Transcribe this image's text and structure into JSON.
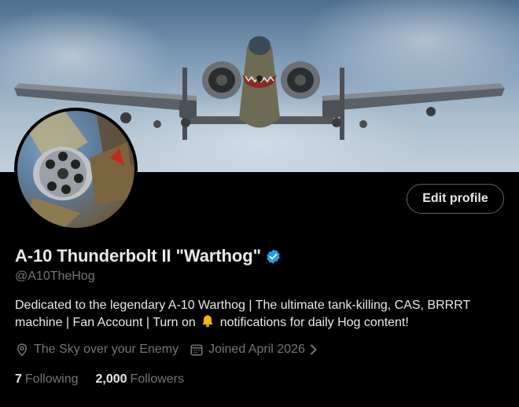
{
  "banner": {
    "image": "A-10 Warthog aircraft flying toward camera against cloudy sky"
  },
  "avatar": {
    "image": "GAU-8 Avenger cannon close-up"
  },
  "profile": {
    "edit_button": "Edit profile",
    "display_name": "A-10 Thunderbolt II \"Warthog\"",
    "handle": "@A10TheHog",
    "bio_part1": "Dedicated to the legendary A-10 Warthog | The ultimate tank-killing, CAS, BRRRT machine | Fan Account | Turn on",
    "bio_part2": "notifications for daily Hog content!",
    "location": "The Sky over your Enemy",
    "joined": "Joined April 2026",
    "following_count": "7",
    "following_label": "Following",
    "followers_count": "2,000",
    "followers_label": "Followers"
  },
  "icons": {
    "verified": "verified-badge-icon",
    "bell": "bell-emoji-icon",
    "location": "location-pin-icon",
    "calendar": "calendar-icon",
    "chevron": "chevron-right-icon"
  },
  "colors": {
    "background": "#000000",
    "text": "#e7e9ea",
    "secondary_text": "#71767b",
    "verified_blue": "#1d9bf0",
    "button_border": "#536471"
  }
}
